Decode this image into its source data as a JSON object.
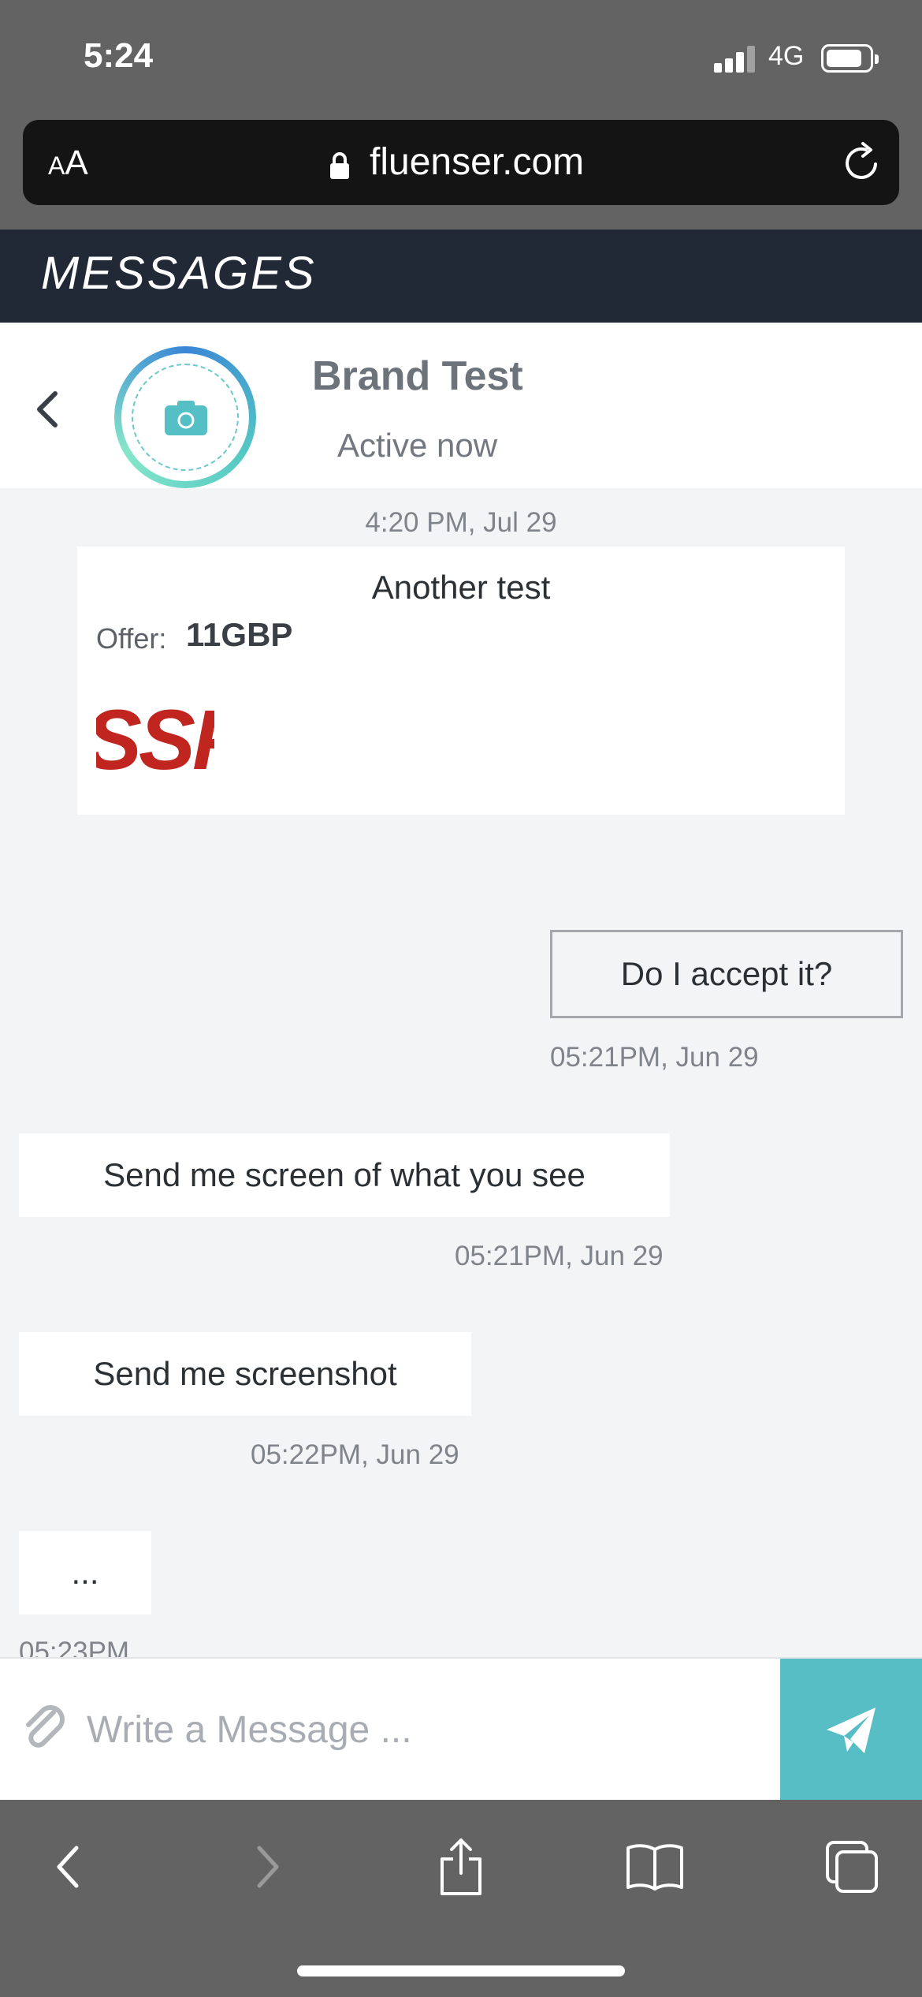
{
  "status_bar": {
    "time": "5:24",
    "network": "4G"
  },
  "browser": {
    "text_size_small": "A",
    "text_size_large": "A",
    "url": "fluenser.com"
  },
  "app_header": {
    "title": "MESSAGES"
  },
  "chat_header": {
    "contact_name": "Brand Test",
    "contact_status": "Active now"
  },
  "messages": {
    "offer": {
      "timestamp": "4:20 PM, Jul 29",
      "title": "Another test",
      "label": "Offer:",
      "amount": "11GBP",
      "logo_text": "SSPA"
    },
    "items": [
      {
        "direction": "sent",
        "text": "Do I accept it?",
        "time": "05:21PM, Jun 29"
      },
      {
        "direction": "received",
        "text": "Send me screen of what you see",
        "time": "05:21PM, Jun 29"
      },
      {
        "direction": "received",
        "text": "Send me screenshot",
        "time": "05:22PM, Jun 29"
      },
      {
        "direction": "received",
        "text": "...",
        "time": "05:23PM"
      }
    ]
  },
  "composer": {
    "placeholder": "Write a Message ..."
  },
  "colors": {
    "header_bg": "#212836",
    "send_button": "#58bec6",
    "chat_bg": "#f3f4f6",
    "logo_red": "#c0261f"
  },
  "icons": {
    "back": "chevron-left-icon",
    "avatar": "camera-icon",
    "attach": "paperclip-icon",
    "send": "paper-plane-icon",
    "browser_back": "chevron-left-icon",
    "browser_forward": "chevron-right-icon",
    "share": "share-icon",
    "bookmarks": "book-icon",
    "tabs": "tabs-icon"
  }
}
